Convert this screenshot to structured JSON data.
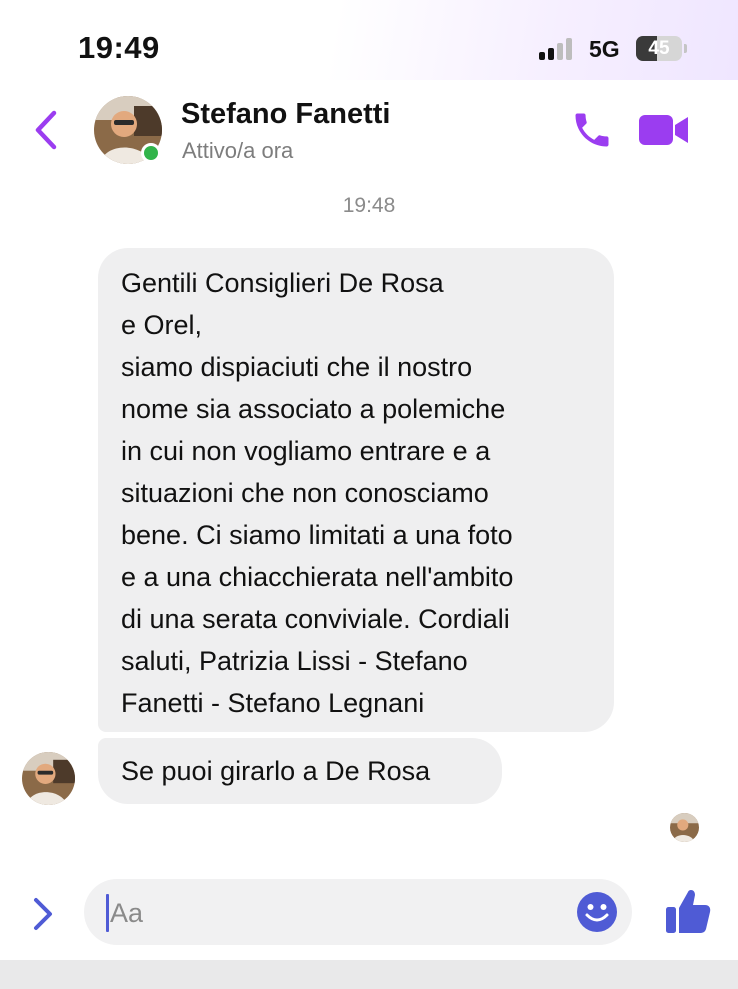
{
  "status_bar": {
    "time": "19:49",
    "network": "5G",
    "battery": "45",
    "battery_level": 0.45
  },
  "header": {
    "contact_name": "Stefano Fanetti",
    "contact_status": "Attivo/a ora"
  },
  "conversation": {
    "timestamp": "19:48",
    "messages": [
      {
        "lines": [
          "Gentili Consiglieri De Rosa",
          "e Orel,",
          "siamo dispiaciuti che il nostro",
          "nome sia associato a polemiche",
          "in cui non vogliamo entrare e a",
          "situazioni che non conosciamo",
          "bene. Ci siamo limitati a una foto",
          "e a una chiacchierata nell'ambito",
          "di una serata conviviale. Cordiali",
          "saluti, Patrizia Lissi - Stefano",
          "Fanetti - Stefano Legnani"
        ]
      },
      {
        "lines": [
          "Se puoi girarlo a De Rosa"
        ]
      }
    ]
  },
  "composer": {
    "placeholder": "Aa"
  },
  "colors": {
    "accent": "#9b3df0",
    "bubble": "#efeff0",
    "online": "#31b44a",
    "send_blue": "#4f5bd5"
  }
}
